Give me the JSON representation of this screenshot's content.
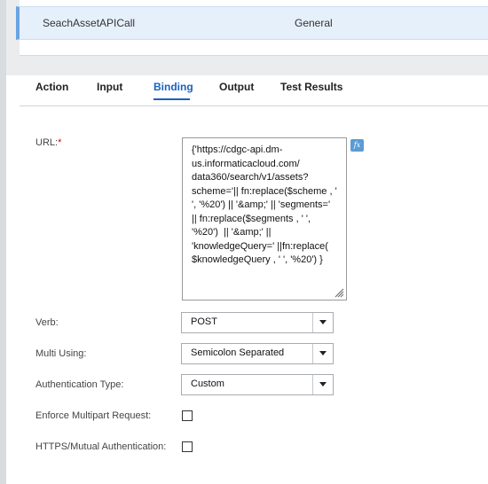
{
  "asset_row": {
    "name": "SeachAssetAPICall",
    "type": "General"
  },
  "tabs": [
    {
      "label": "Action",
      "active": false
    },
    {
      "label": "Input",
      "active": false
    },
    {
      "label": "Binding",
      "active": true
    },
    {
      "label": "Output",
      "active": false
    },
    {
      "label": "Test Results",
      "active": false
    }
  ],
  "form": {
    "url_label": "URL:",
    "url_required_mark": "*",
    "url_lines": [
      "{'https://cdgc-api.dm-",
      "us.informaticacloud.com/",
      "data360/search/v1/assets?",
      "scheme='|| fn:replace($scheme , '",
      "', '%20') || '&amp;' || 'segments='",
      "|| fn:replace($segments , ' ',",
      "'%20')  || '&amp;' ||",
      "'knowledgeQuery=' ||fn:replace(",
      "$knowledgeQuery , ' ', '%20') }"
    ],
    "fx_icon_text": "fx",
    "verb_label": "Verb:",
    "verb_value": "POST",
    "multi_using_label": "Multi Using:",
    "multi_using_value": "Semicolon Separated",
    "auth_type_label": "Authentication Type:",
    "auth_type_value": "Custom",
    "enforce_multipart_label": "Enforce Multipart Request:",
    "enforce_multipart_checked": false,
    "https_mutual_label": "HTTPS/Mutual Authentication:",
    "https_mutual_checked": false
  },
  "colors": {
    "accent": "#1a61c0",
    "selected_row_bg": "#e6f0fb",
    "required": "#d0021b",
    "fx_icon_bg": "#5b9bd5"
  },
  "icons": {
    "fx": "fx-icon",
    "resize": "resize-grip-icon",
    "dropdown": "chevron-down-icon"
  }
}
